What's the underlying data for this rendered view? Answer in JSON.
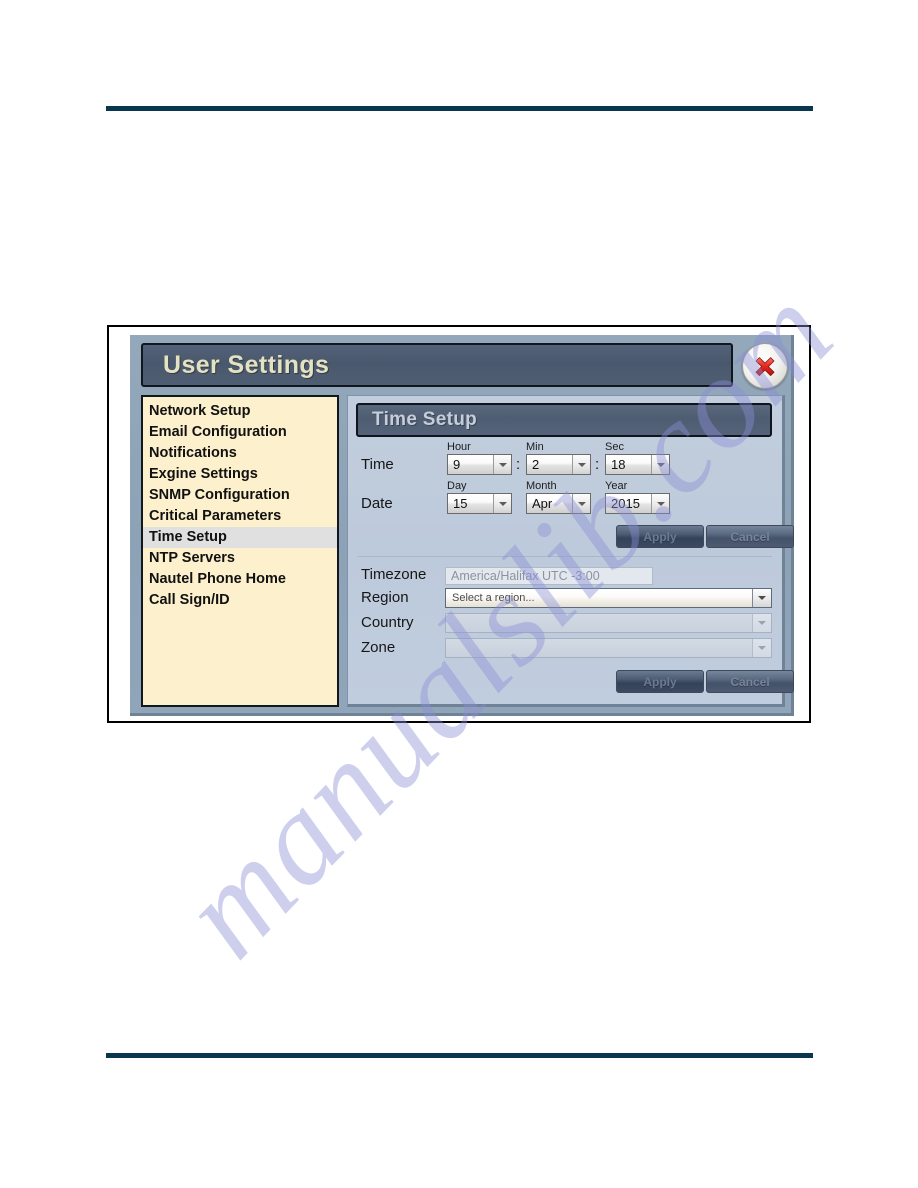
{
  "document": {
    "rules": {
      "color": "#093750"
    },
    "watermark": {
      "text": "manualslib.com"
    }
  },
  "dialog": {
    "title": "User Settings",
    "close_icon": "close-x-icon"
  },
  "sidebar": {
    "items": [
      {
        "label": "Network Setup",
        "selected": false
      },
      {
        "label": "Email Configuration",
        "selected": false
      },
      {
        "label": "Notifications",
        "selected": false
      },
      {
        "label": "Exgine Settings",
        "selected": false
      },
      {
        "label": "SNMP Configuration",
        "selected": false
      },
      {
        "label": "Critical Parameters",
        "selected": false
      },
      {
        "label": "Time Setup",
        "selected": true
      },
      {
        "label": "NTP Servers",
        "selected": false
      },
      {
        "label": "Nautel Phone Home",
        "selected": false
      },
      {
        "label": "Call Sign/ID",
        "selected": false
      }
    ]
  },
  "panel": {
    "title": "Time Setup",
    "time_row": {
      "label": "Time",
      "hour": {
        "caption": "Hour",
        "value": "9"
      },
      "min": {
        "caption": "Min",
        "value": "2"
      },
      "sec": {
        "caption": "Sec",
        "value": "18"
      },
      "separator": ":"
    },
    "date_row": {
      "label": "Date",
      "day": {
        "caption": "Day",
        "value": "15"
      },
      "month": {
        "caption": "Month",
        "value": "Apr"
      },
      "year": {
        "caption": "Year",
        "value": "2015"
      }
    },
    "time_actions": {
      "apply_label": "Apply",
      "cancel_label": "Cancel"
    },
    "timezone_section": {
      "timezone": {
        "label": "Timezone",
        "value": "America/Halifax UTC -3:00"
      },
      "region": {
        "label": "Region",
        "value": "Select a region..."
      },
      "country": {
        "label": "Country",
        "value": ""
      },
      "zone": {
        "label": "Zone",
        "value": ""
      }
    },
    "timezone_actions": {
      "apply_label": "Apply",
      "cancel_label": "Cancel"
    }
  }
}
